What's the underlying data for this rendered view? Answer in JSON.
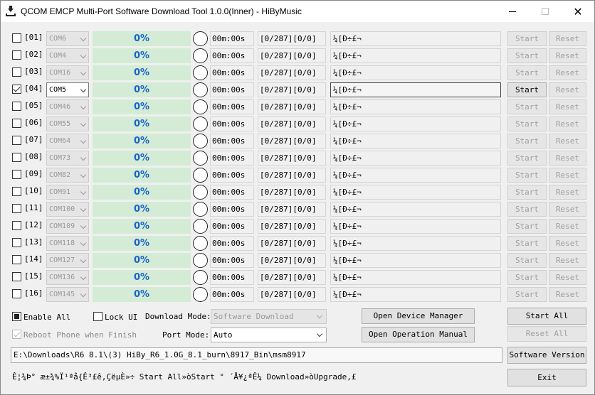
{
  "window": {
    "title": "QCOM EMCP Multi-Port Software Download Tool 1.0.0(Inner) - HiByMusic",
    "icon": "download-tray-icon"
  },
  "ports": [
    {
      "index": "[01]",
      "checked": false,
      "com": "COM6",
      "active": false,
      "progress": "0%",
      "time": "00m:00s",
      "count": "[0/287][0/0]",
      "message": "¼[Ð÷£¬",
      "start": "Start",
      "reset": "Reset"
    },
    {
      "index": "[02]",
      "checked": false,
      "com": "COM4",
      "active": false,
      "progress": "0%",
      "time": "00m:00s",
      "count": "[0/287][0/0]",
      "message": "¼[Ð÷£¬",
      "start": "Start",
      "reset": "Reset"
    },
    {
      "index": "[03]",
      "checked": false,
      "com": "COM16",
      "active": false,
      "progress": "0%",
      "time": "00m:00s",
      "count": "[0/287][0/0]",
      "message": "¼[Ð÷£¬",
      "start": "Start",
      "reset": "Reset"
    },
    {
      "index": "[04]",
      "checked": true,
      "com": "COM5",
      "active": true,
      "progress": "0%",
      "time": "00m:00s",
      "count": "[0/287][0/0]",
      "message": "¼[Ð÷£¬",
      "start": "Start",
      "reset": "Reset"
    },
    {
      "index": "[05]",
      "checked": false,
      "com": "COM46",
      "active": false,
      "progress": "0%",
      "time": "00m:00s",
      "count": "[0/287][0/0]",
      "message": "¼[Ð÷£¬",
      "start": "Start",
      "reset": "Reset"
    },
    {
      "index": "[06]",
      "checked": false,
      "com": "COM55",
      "active": false,
      "progress": "0%",
      "time": "00m:00s",
      "count": "[0/287][0/0]",
      "message": "¼[Ð÷£¬",
      "start": "Start",
      "reset": "Reset"
    },
    {
      "index": "[07]",
      "checked": false,
      "com": "COM64",
      "active": false,
      "progress": "0%",
      "time": "00m:00s",
      "count": "[0/287][0/0]",
      "message": "¼[Ð÷£¬",
      "start": "Start",
      "reset": "Reset"
    },
    {
      "index": "[08]",
      "checked": false,
      "com": "COM73",
      "active": false,
      "progress": "0%",
      "time": "00m:00s",
      "count": "[0/287][0/0]",
      "message": "¼[Ð÷£¬",
      "start": "Start",
      "reset": "Reset"
    },
    {
      "index": "[09]",
      "checked": false,
      "com": "COM82",
      "active": false,
      "progress": "0%",
      "time": "00m:00s",
      "count": "[0/287][0/0]",
      "message": "¼[Ð÷£¬",
      "start": "Start",
      "reset": "Reset"
    },
    {
      "index": "[10]",
      "checked": false,
      "com": "COM91",
      "active": false,
      "progress": "0%",
      "time": "00m:00s",
      "count": "[0/287][0/0]",
      "message": "¼[Ð÷£¬",
      "start": "Start",
      "reset": "Reset"
    },
    {
      "index": "[11]",
      "checked": false,
      "com": "COM100",
      "active": false,
      "progress": "0%",
      "time": "00m:00s",
      "count": "[0/287][0/0]",
      "message": "¼[Ð÷£¬",
      "start": "Start",
      "reset": "Reset"
    },
    {
      "index": "[12]",
      "checked": false,
      "com": "COM109",
      "active": false,
      "progress": "0%",
      "time": "00m:00s",
      "count": "[0/287][0/0]",
      "message": "¼[Ð÷£¬",
      "start": "Start",
      "reset": "Reset"
    },
    {
      "index": "[13]",
      "checked": false,
      "com": "COM118",
      "active": false,
      "progress": "0%",
      "time": "00m:00s",
      "count": "[0/287][0/0]",
      "message": "¼[Ð÷£¬",
      "start": "Start",
      "reset": "Reset"
    },
    {
      "index": "[14]",
      "checked": false,
      "com": "COM127",
      "active": false,
      "progress": "0%",
      "time": "00m:00s",
      "count": "[0/287][0/0]",
      "message": "¼[Ð÷£¬",
      "start": "Start",
      "reset": "Reset"
    },
    {
      "index": "[15]",
      "checked": false,
      "com": "COM136",
      "active": false,
      "progress": "0%",
      "time": "00m:00s",
      "count": "[0/287][0/0]",
      "message": "¼[Ð÷£¬",
      "start": "Start",
      "reset": "Reset"
    },
    {
      "index": "[16]",
      "checked": false,
      "com": "COM145",
      "active": false,
      "progress": "0%",
      "time": "00m:00s",
      "count": "[0/287][0/0]",
      "message": "¼[Ð÷£¬",
      "start": "Start",
      "reset": "Reset"
    }
  ],
  "controls": {
    "enable_all": "Enable All",
    "lock_ui": "Lock UI",
    "download_mode_label": "Download Mode:",
    "download_mode_value": "Software Download",
    "reboot_phone": "Reboot Phone when Finish",
    "port_mode_label": "Port Mode:",
    "port_mode_value": "Auto",
    "open_device_manager": "Open Device Manager",
    "open_operation_manual": "Open Operation Manual",
    "start_all": "Start All",
    "reset_all": "Reset All",
    "software_version": "Software Version",
    "exit": "Exit"
  },
  "path": "E:\\Downloads\\R6 8.1\\(3) HiBy_R6_1.0G_8.1_burn\\8917_Bin\\msm8917",
  "status": "Ê¦¾Þ° æ±¾%Ï¹ªå{Ê³£ê,ÇëµÈ»÷ Start All»òStart ° ´Å¥¿ªÊ¼ Download»òUpgrade,£",
  "colors": {
    "progress_bg": "#d4ecd5",
    "progress_text": "#1a64c8"
  }
}
